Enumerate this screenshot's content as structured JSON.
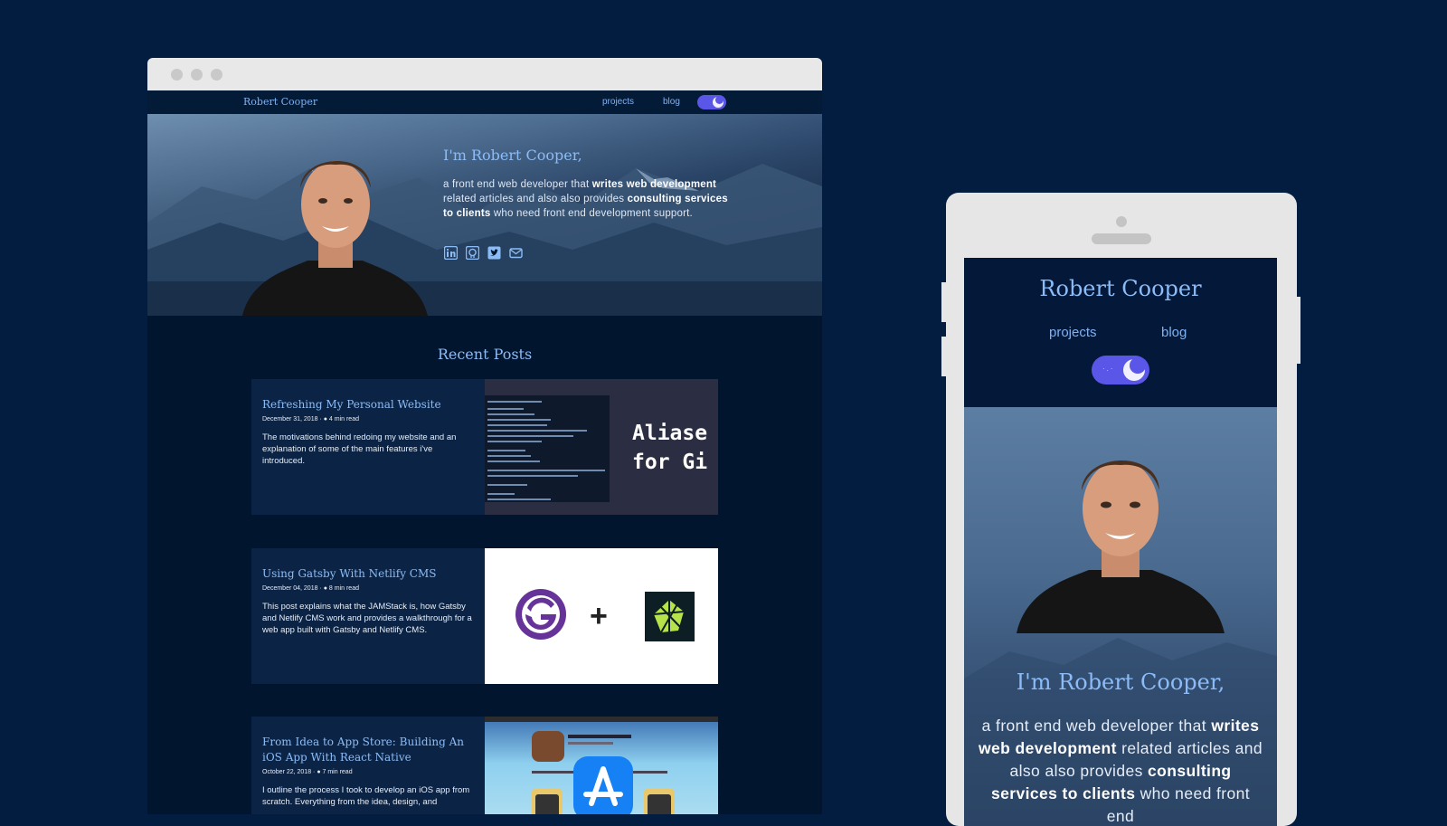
{
  "desktop": {
    "nav": {
      "brand": "Robert Cooper",
      "projects": "projects",
      "blog": "blog"
    },
    "hero": {
      "title": "I'm Robert Cooper,",
      "text_1": "a front end web developer that ",
      "text_bold_1": "writes web development",
      "text_2": " related articles and also also provides ",
      "text_bold_2": "consulting services to clients",
      "text_3": " who need front end development support."
    },
    "social_icons": [
      "linkedin-icon",
      "github-icon",
      "twitter-icon",
      "email-icon"
    ],
    "recent_heading": "Recent Posts",
    "posts": [
      {
        "title": "Refreshing My Personal Website",
        "date": "December 31, 2018",
        "read": "4 min read",
        "description": "The motivations behind redoing my website and an explanation of some of the main features i've introduced.",
        "thumb_text_1": "Aliase",
        "thumb_text_2": "for Gi"
      },
      {
        "title": "Using Gatsby With Netlify CMS",
        "date": "December 04, 2018",
        "read": "8 min read",
        "description": "This post explains what the JAMStack is, how Gatsby and Netlify CMS work and provides a walkthrough for a web app built with Gatsby and Netlify CMS.",
        "thumb_plus": "+"
      },
      {
        "title": "From Idea to App Store: Building An iOS App With React Native",
        "date": "October 22, 2018",
        "read": "7 min read",
        "description": "I outline the process I took to develop an iOS app from scratch. Everything from the idea, design, and"
      }
    ]
  },
  "mobile": {
    "brand": "Robert Cooper",
    "projects": "projects",
    "blog": "blog",
    "hero_title": "I'm Robert Cooper,",
    "text_1": "a front end web developer that ",
    "text_bold_1": "writes web development",
    "text_2": " related articles and also also provides ",
    "text_bold_2": "consulting services to clients",
    "text_3": " who need front end"
  },
  "colors": {
    "page_bg": "#021d3f",
    "accent": "#8cbcf7",
    "toggle": "#5a56e8"
  }
}
